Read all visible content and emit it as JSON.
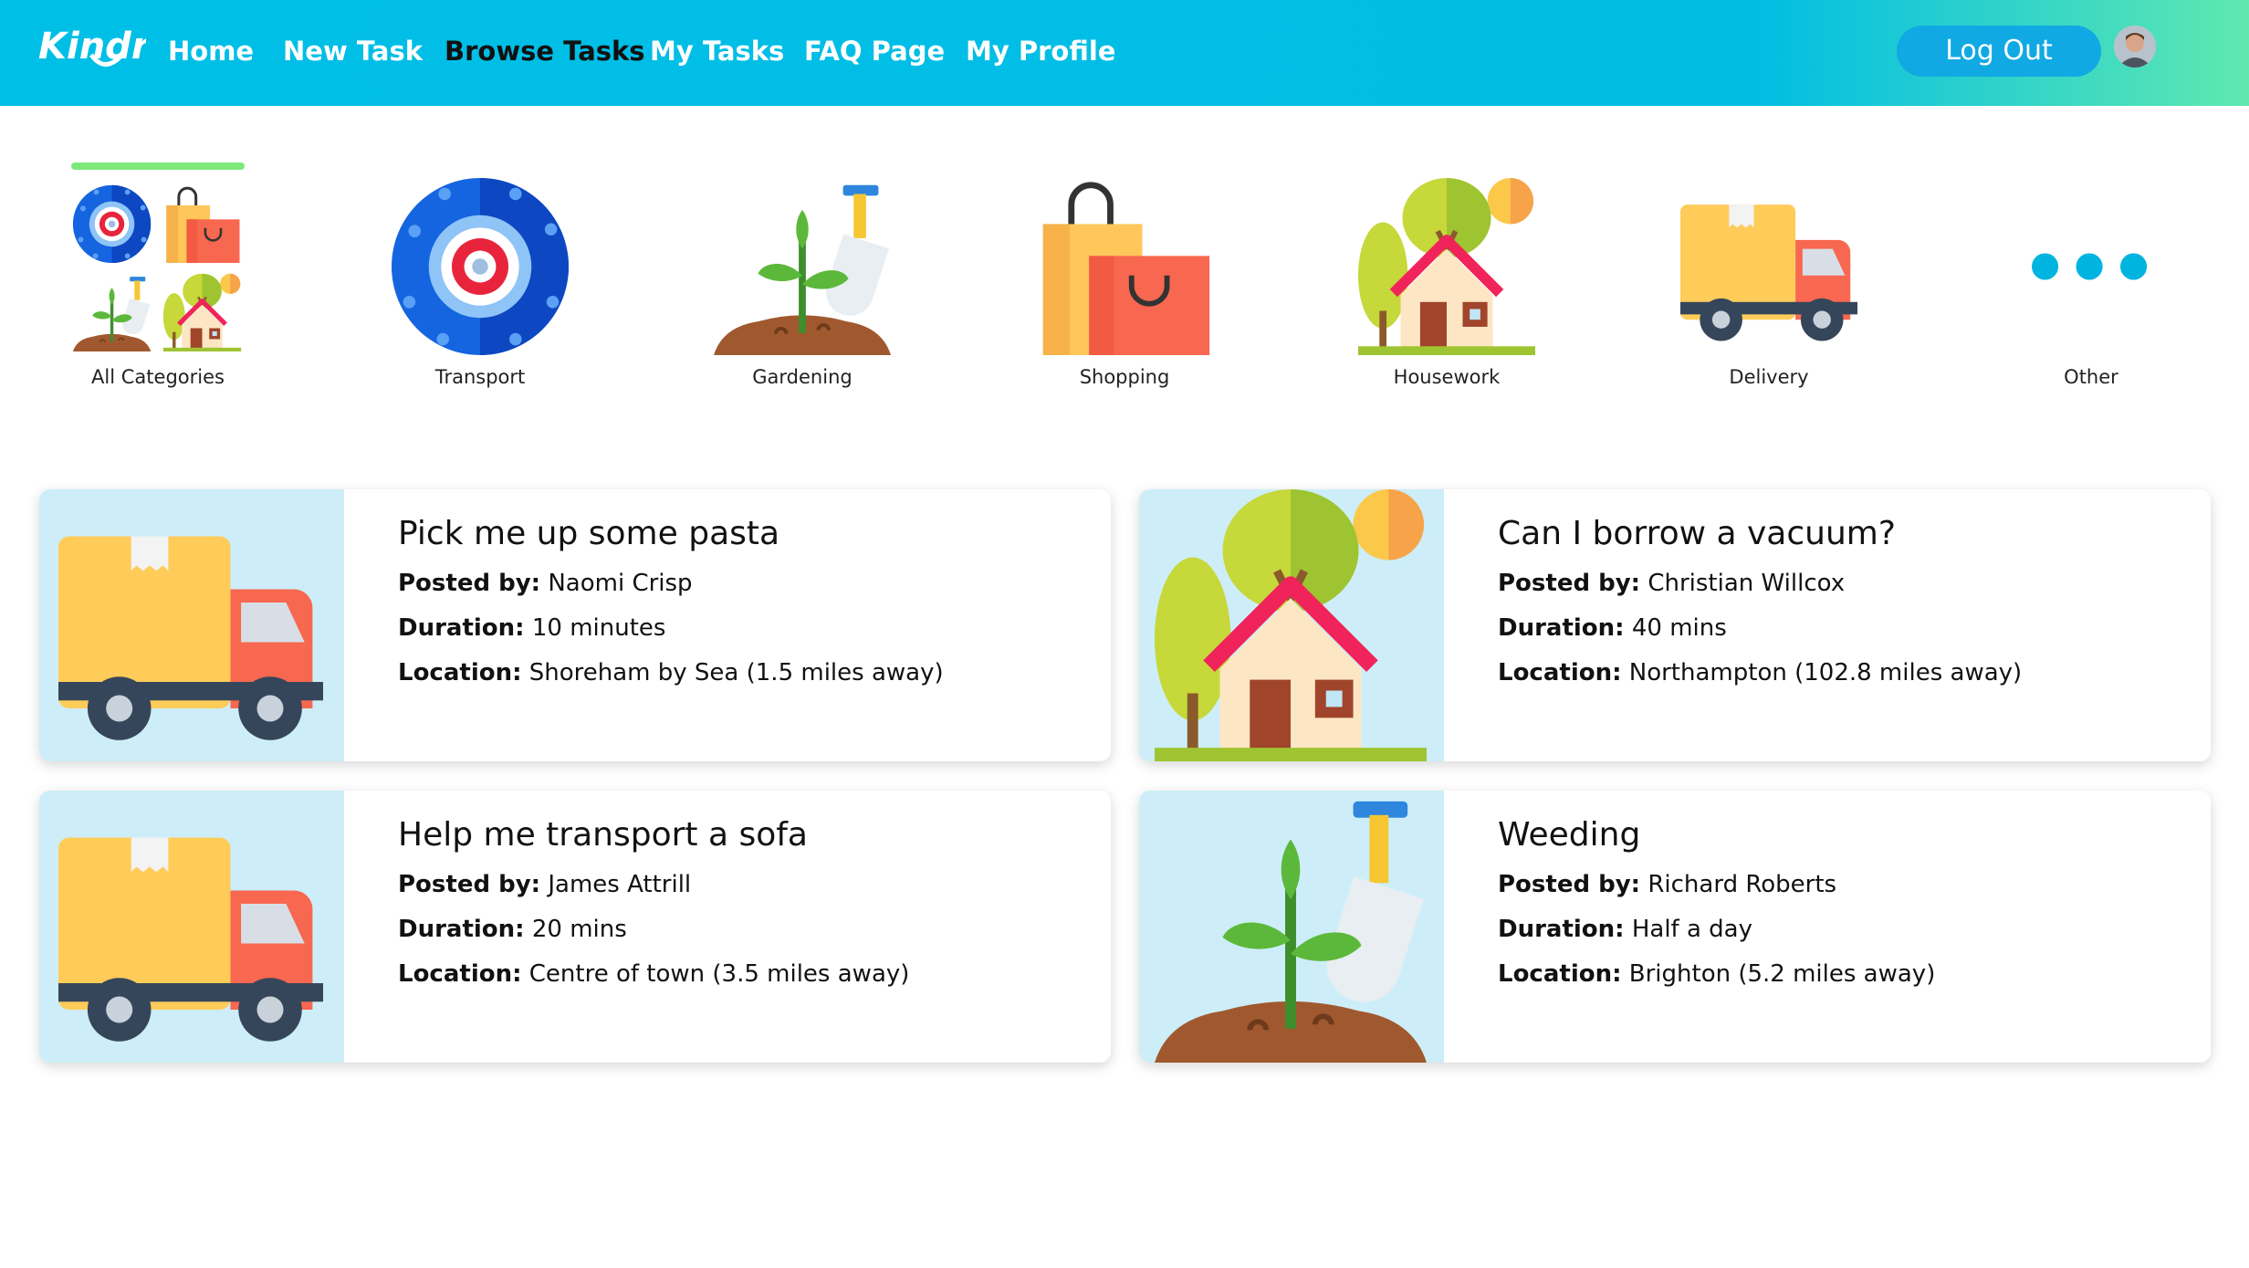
{
  "nav": {
    "logo_text": "Kindr",
    "links": [
      "Home",
      "New Task",
      "Browse Tasks",
      "My Tasks",
      "FAQ Page",
      "My Profile"
    ],
    "active_link": "Browse Tasks",
    "logout_label": "Log Out",
    "avatar_icon": "user-avatar"
  },
  "categories": [
    {
      "label": "All Categories",
      "icon": "all-categories-icon",
      "selected": true
    },
    {
      "label": "Transport",
      "icon": "tyre-icon",
      "selected": false
    },
    {
      "label": "Gardening",
      "icon": "plant-shovel-icon",
      "selected": false
    },
    {
      "label": "Shopping",
      "icon": "shopping-bags-icon",
      "selected": false
    },
    {
      "label": "Housework",
      "icon": "house-icon",
      "selected": false
    },
    {
      "label": "Delivery",
      "icon": "truck-icon",
      "selected": false
    },
    {
      "label": "Other",
      "icon": "dots-icon",
      "selected": false
    }
  ],
  "field_labels": {
    "posted_by": "Posted by:",
    "duration": "Duration:",
    "location": "Location:"
  },
  "tasks": [
    {
      "title": "Pick me up some pasta",
      "posted_by": "Naomi Crisp",
      "duration": "10 minutes",
      "location": "Shoreham by Sea (1.5 miles away)",
      "icon": "truck-icon"
    },
    {
      "title": "Can I borrow a vacuum?",
      "posted_by": "Christian Willcox",
      "duration": "40 mins",
      "location": "Northampton (102.8 miles away)",
      "icon": "house-icon"
    },
    {
      "title": "Help me transport a sofa",
      "posted_by": "James Attrill",
      "duration": "20 mins",
      "location": "Centre of town (3.5 miles away)",
      "icon": "truck-icon"
    },
    {
      "title": "Weeding",
      "posted_by": "Richard Roberts",
      "duration": "Half a day",
      "location": "Brighton (5.2 miles away)",
      "icon": "plant-shovel-icon"
    }
  ],
  "colors": {
    "nav_gradient_start": "#00bfe6",
    "nav_gradient_end": "#5fe8b0",
    "logout_button": "#10a9e3",
    "selected_underline": "#7ee87a",
    "thumb_background": "#cdeef8",
    "dots": "#00b4e0"
  }
}
